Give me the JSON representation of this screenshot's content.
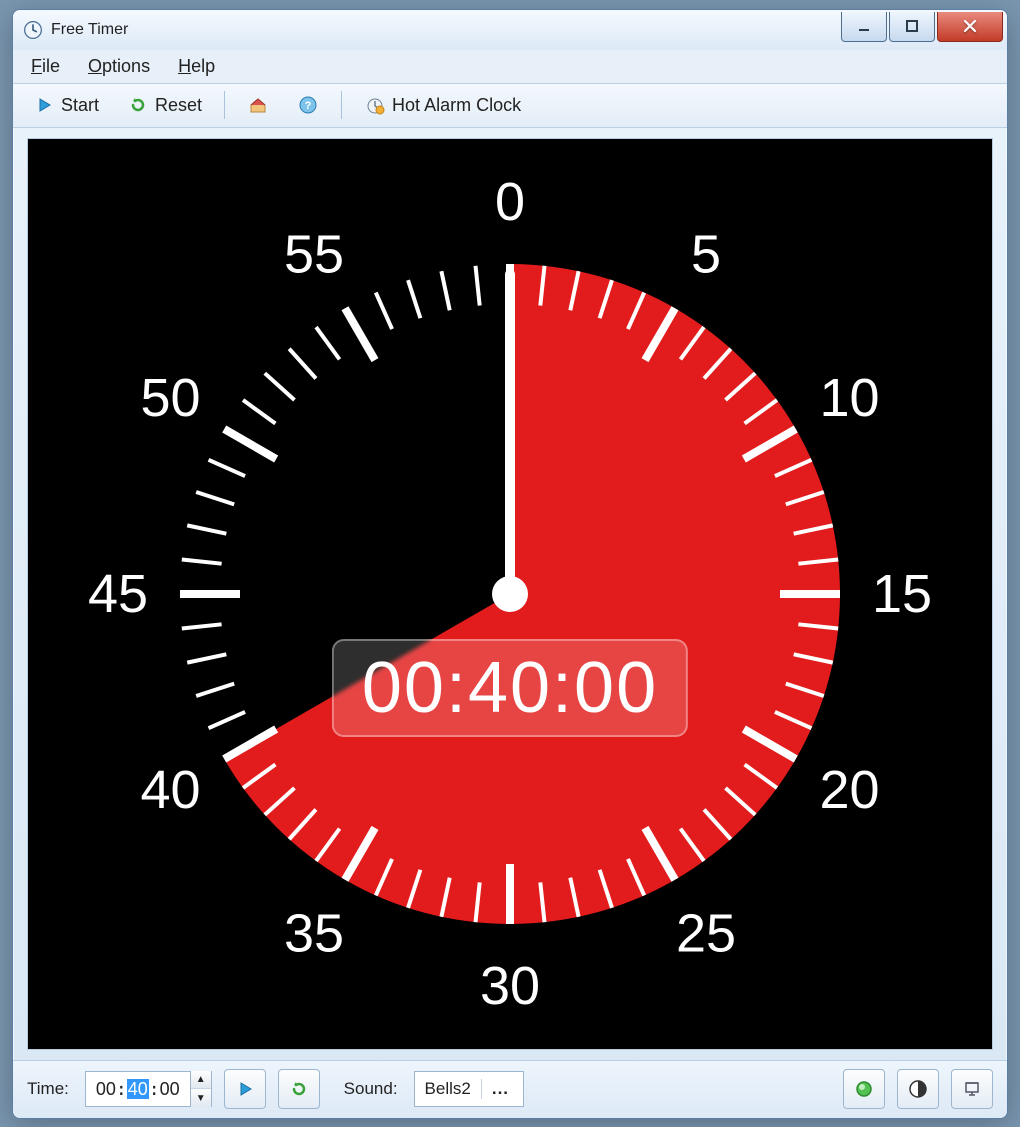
{
  "window": {
    "title": "Free Timer"
  },
  "menubar": {
    "file": "File",
    "options": "Options",
    "help": "Help"
  },
  "toolbar": {
    "start_label": "Start",
    "reset_label": "Reset",
    "hot_alarm_label": "Hot Alarm Clock"
  },
  "clock": {
    "digital": "00:40:00",
    "dial_labels": [
      "0",
      "5",
      "10",
      "15",
      "20",
      "25",
      "30",
      "35",
      "40",
      "45",
      "50",
      "55"
    ],
    "filled_minutes": 40
  },
  "status": {
    "time_label": "Time:",
    "time_h": "00",
    "time_m": "40",
    "time_s": "00",
    "sound_label": "Sound:",
    "sound_value": "Bells2",
    "sound_more": "..."
  }
}
